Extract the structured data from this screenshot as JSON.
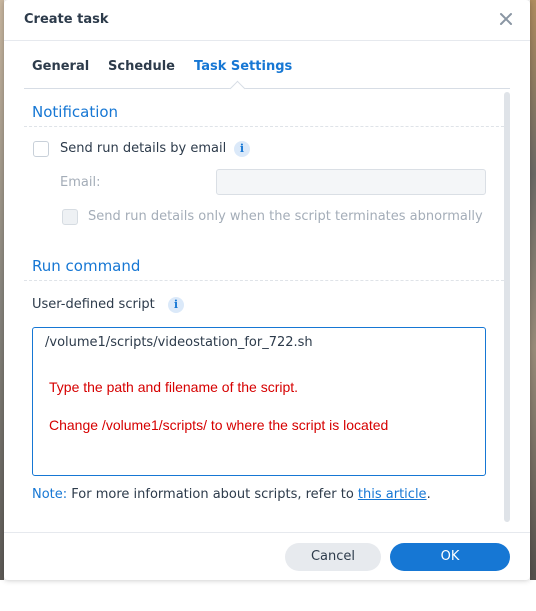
{
  "dialog": {
    "title": "Create task",
    "close_icon": "close-icon"
  },
  "tabs": [
    {
      "label": "General",
      "active": false
    },
    {
      "label": "Schedule",
      "active": false
    },
    {
      "label": "Task Settings",
      "active": true
    }
  ],
  "notification": {
    "section_title": "Notification",
    "send_details_label": "Send run details by email",
    "send_details_checked": false,
    "email_label": "Email:",
    "email_value": "",
    "abnormal_only_label": "Send run details only when the script terminates abnormally",
    "abnormal_only_checked": false
  },
  "run_command": {
    "section_title": "Run command",
    "script_label": "User-defined script",
    "script_value": "/volume1/scripts/videostation_for_722.sh"
  },
  "annotations": {
    "line1": "Type the path and filename of the script.",
    "line2": "Change /volume1/scripts/ to where the script is located"
  },
  "note": {
    "label": "Note:",
    "text": "For more information about scripts, refer to",
    "link_text": "this article",
    "suffix": "."
  },
  "footer": {
    "cancel_label": "Cancel",
    "ok_label": "OK"
  },
  "colors": {
    "accent": "#1677d4",
    "annotation": "#d60000",
    "text": "#2d3b4b"
  }
}
